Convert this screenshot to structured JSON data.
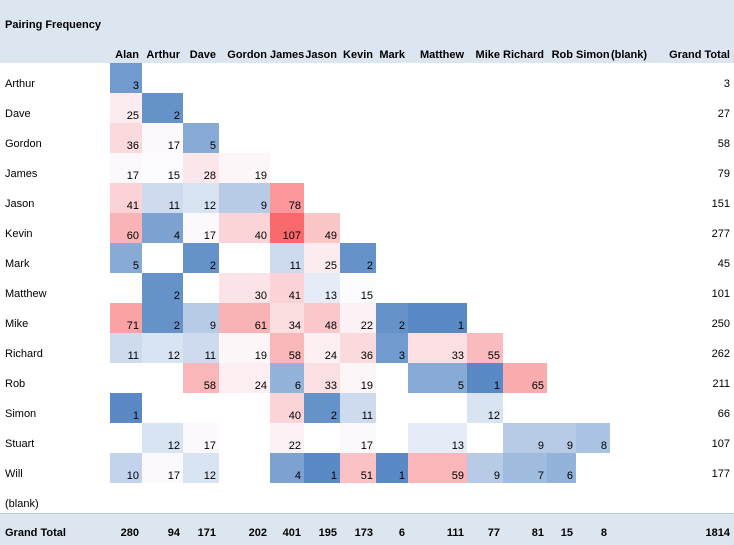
{
  "title": "Pairing Frequency",
  "columns": [
    "Alan",
    "Arthur",
    "Dave",
    "Gordon",
    "James",
    "Jason",
    "Kevin",
    "Mark",
    "Matthew",
    "Mike",
    "Richard",
    "Rob",
    "Simon",
    "(blank)"
  ],
  "grand_total_label": "Grand Total",
  "rows": [
    {
      "name": "Arthur",
      "values": [
        3,
        null,
        null,
        null,
        null,
        null,
        null,
        null,
        null,
        null,
        null,
        null,
        null,
        null
      ],
      "total": 3
    },
    {
      "name": "Dave",
      "values": [
        25,
        2,
        null,
        null,
        null,
        null,
        null,
        null,
        null,
        null,
        null,
        null,
        null,
        null
      ],
      "total": 27
    },
    {
      "name": "Gordon",
      "values": [
        36,
        17,
        5,
        null,
        null,
        null,
        null,
        null,
        null,
        null,
        null,
        null,
        null,
        null
      ],
      "total": 58
    },
    {
      "name": "James",
      "values": [
        17,
        15,
        28,
        19,
        null,
        null,
        null,
        null,
        null,
        null,
        null,
        null,
        null,
        null
      ],
      "total": 79
    },
    {
      "name": "Jason",
      "values": [
        41,
        11,
        12,
        9,
        78,
        null,
        null,
        null,
        null,
        null,
        null,
        null,
        null,
        null
      ],
      "total": 151
    },
    {
      "name": "Kevin",
      "values": [
        60,
        4,
        17,
        40,
        107,
        49,
        null,
        null,
        null,
        null,
        null,
        null,
        null,
        null
      ],
      "total": 277
    },
    {
      "name": "Mark",
      "values": [
        5,
        null,
        2,
        null,
        11,
        25,
        2,
        null,
        null,
        null,
        null,
        null,
        null,
        null
      ],
      "total": 45
    },
    {
      "name": "Matthew",
      "values": [
        null,
        2,
        null,
        30,
        41,
        13,
        15,
        null,
        null,
        null,
        null,
        null,
        null,
        null
      ],
      "total": 101
    },
    {
      "name": "Mike",
      "values": [
        71,
        2,
        9,
        61,
        34,
        48,
        22,
        2,
        1,
        null,
        null,
        null,
        null,
        null
      ],
      "total": 250
    },
    {
      "name": "Richard",
      "values": [
        11,
        12,
        11,
        19,
        58,
        24,
        36,
        3,
        33,
        55,
        null,
        null,
        null,
        null
      ],
      "total": 262
    },
    {
      "name": "Rob",
      "values": [
        null,
        null,
        58,
        24,
        6,
        33,
        19,
        null,
        5,
        1,
        65,
        null,
        null,
        null
      ],
      "total": 211
    },
    {
      "name": "Simon",
      "values": [
        1,
        null,
        null,
        null,
        40,
        2,
        11,
        null,
        null,
        12,
        null,
        null,
        null,
        null
      ],
      "total": 66
    },
    {
      "name": "Stuart",
      "values": [
        null,
        12,
        17,
        null,
        22,
        null,
        17,
        null,
        13,
        null,
        9,
        9,
        8,
        null
      ],
      "total": 107
    },
    {
      "name": "Will",
      "values": [
        10,
        17,
        12,
        null,
        4,
        1,
        51,
        1,
        59,
        9,
        7,
        6,
        null,
        null
      ],
      "total": 177
    },
    {
      "name": "(blank)",
      "values": [
        null,
        null,
        null,
        null,
        null,
        null,
        null,
        null,
        null,
        null,
        null,
        null,
        null,
        null
      ],
      "total": null
    }
  ],
  "grand_totals": [
    280,
    94,
    171,
    202,
    401,
    195,
    173,
    6,
    111,
    77,
    81,
    15,
    8,
    null
  ],
  "grand_total_overall": 1814,
  "colors": {
    "header_band": "#dce6f1",
    "low": "#5a8ac6",
    "mid": "#fcfcff",
    "high": "#f8696b"
  }
}
